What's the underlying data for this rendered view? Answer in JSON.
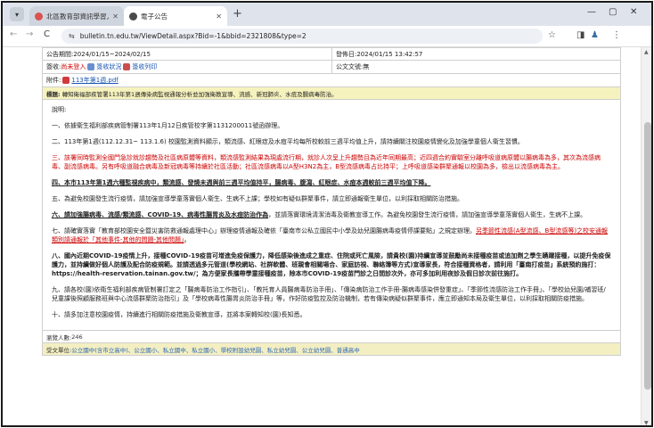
{
  "browser": {
    "tabs": [
      {
        "title": "北區教育部資訊學習入口網",
        "active": false,
        "favicon_color": "#d9534f"
      },
      {
        "title": "電子公告",
        "active": true,
        "favicon_color": "#4a4a4a"
      }
    ],
    "tab_menu_glyph": "▾",
    "new_tab_glyph": "+",
    "window_controls": {
      "minimize": "—",
      "maximize": "▢",
      "close": "✕"
    },
    "nav": {
      "back": "←",
      "forward": "→",
      "reload": "C"
    },
    "url": "bulletin.tn.edu.tw/ViewDetail.aspx?Bid=-1&bbid=2321808&type=2",
    "icons": {
      "tune": "⇆",
      "star": "☆",
      "sidebar": "◨",
      "profile": "♟",
      "menu": "⋮"
    }
  },
  "notice": {
    "period": "公告期間:2024/01/15~2024/02/15",
    "published": "發佈日:2024/01/15 13:42:57",
    "status_prefix": "簽收:",
    "status_unsigned": "尚未登入",
    "status_new": "簽收狀況",
    "status_print": "簽收列印",
    "official_no": "公文文號:無",
    "attachment_label": "附件:",
    "attachment_file": "113年第1週.pdf",
    "subject_label": "標題:",
    "subject": "轉知衛福部疾管署113年第1週傳染病監視通報分析並加強衛教宣導、流感、新冠肺炎、水痘及腸病毒防治。",
    "lead": "說明:",
    "paragraphs": [
      {
        "id": "p1",
        "text": "一、依據衛生福利部疾病管制署113年1月12日疾管校字第1131200011號函辦理。"
      },
      {
        "id": "p2",
        "text": "二、113年第1週(112.12.31~ 113.1.6) 校園監測資料顯示，類流感、紅眼症及水痘平均每所校較前三週平均值上升，請持續關注校園疫情變化及加強學童個人衛生習慣。"
      },
      {
        "id": "p3",
        "text": "三、該署同時監測全國門急診就診趨勢及社區病原體等資料，類流感監測結果為現處流行期，就診人次呈上升趨勢且為近年同期最高；近四週合約實驗室分離呼吸道病原體以腸病毒為多，其次為流感病毒、副流感病毒。另有呼吸道融合病毒及新冠病毒等持續於社區活動；社區流感病毒以A型H3N2為主，B型流感病毒占比持平；上呼吸道感染群聚通報以校園為多，檢出以流感病毒為主。"
      },
      {
        "id": "p4",
        "text": "四、本市113年第1週六種監視疾病中，類流感、發燒未週與前三週平均值持平，腸病毒、腹瀉、紅眼症、水痘本週較前三週平均值下降。"
      },
      {
        "id": "p5",
        "text": "五、為避免校園發生流行疫情，請加強宣導學童落實個人衛生、生病不上課；學校如有疑似群聚事件，請立即通報衛生單位，以利採取相關防治措施。"
      },
      {
        "id": "p6_a",
        "text": "六、請加強腸病毒、流感/類流感、COVID-19、病毒性腸胃炎及水痘防治作為"
      },
      {
        "id": "p6_b",
        "text": "，並請落實環境清潔消毒及衛教宣導工作。為避免校園發生流行疫情，請加強宣導學童落實個人衛生，生病不上課。"
      },
      {
        "id": "p7_a",
        "text": "七、請確實落實「教育部校園安全暨災害防救通報處理中心」辦理疫情通報及確依「臺南市公私立國民中小學及幼兒園腸病毒疫情停課要點」之規定辦理。"
      },
      {
        "id": "p7_b",
        "text": "另季節性流感(A型流感、B型流感等)之校安通報類別請通報於「其他事件-其他的問題-其他問題」"
      },
      {
        "id": "p7_c",
        "text": "。"
      },
      {
        "id": "p8_a",
        "text": "八、國內近期COVID-19疫情上升，接種COVID-19疫苗可增進免疫保護力，降低感染後進成之重症、住院或死亡風險，請貴校(園)持續宣導並鼓勵尚未接種疫苗或追加劑之學生踴躍接種，以提升免疫保護力，並持續做好個人防護及配合防疫規範。並請透過多元管道(學校網站、社群軟體、班親會相關場合、家庭訪視、聯絡簿等方式)宣導家長，符合接種資格者，請利用「臺南打疫苗」系統預約施打："
      },
      {
        "id": "p8_url",
        "text": "https://health-reservation.tainan.gov.tw/"
      },
      {
        "id": "p8_b",
        "text": "；為方便家長攜帶學童接種疫苗，除本市COVID-19疫苗門診之日間診次外，亦可多加利用夜診及假日診次前往施打。"
      },
      {
        "id": "p9",
        "text": "九、請各校(園)依衛生福利部疾病管制署訂定之「腸病毒防治工作指引」、「教托育人員腸病毒防治手冊」、「傳染病防治工作手冊-腸病毒感染併發重症」、「季節性流感防治工作手冊」、「學校幼兒園/補習班/兒童課後照顧服務班與中心流感群聚防治指引」及「學校病毒性腸胃炎防治手冊」等，作好防疫監控及防治機制，若有傳染病疑似群聚事件，應立即通知本局及衛生單位，以利採取相關防疫措施。"
      },
      {
        "id": "p10",
        "text": "十、請多加注意校園疫情，持續進行相關防疫措施及衛教宣導，並將本案轉知校(園)長知悉。"
      }
    ],
    "views_label": "瀏覽人數:",
    "views": "246",
    "audience_label": "受文單位:",
    "audience": "公立國中(含市立高中)、公立國小、私立國中、私立國小、學校附設幼兒園、私立幼兒園、公立幼兒園、普通高中"
  },
  "colors": {
    "accent_red": "#cc0000",
    "link_blue": "#1a55b0",
    "tag_bg": "#f6f2bd"
  }
}
